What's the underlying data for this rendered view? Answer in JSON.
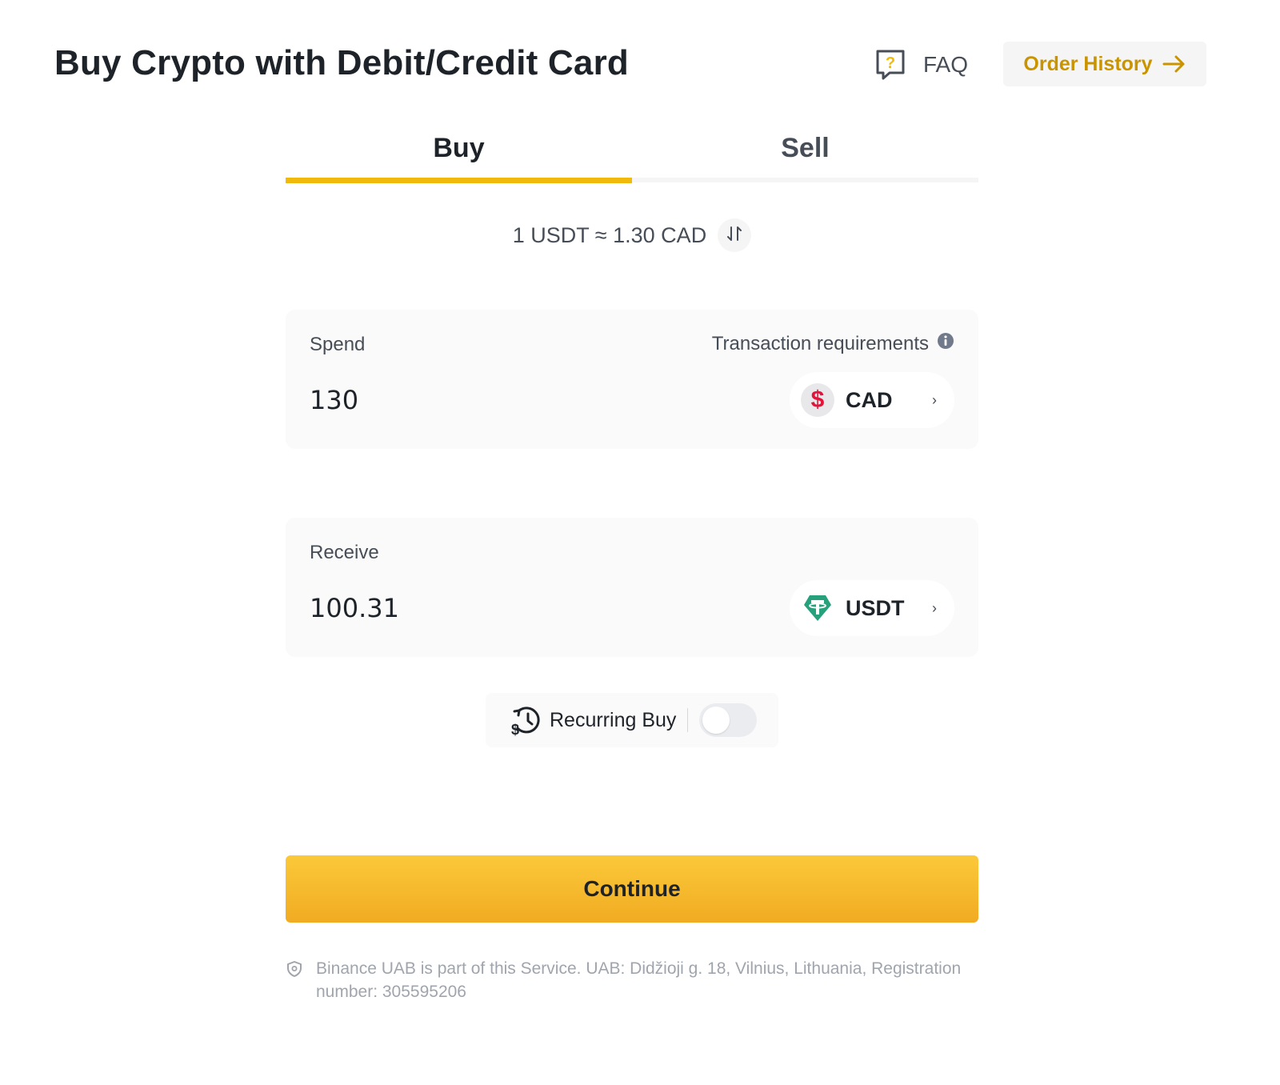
{
  "header": {
    "title": "Buy Crypto with Debit/Credit Card",
    "faq_label": "FAQ",
    "order_history_label": "Order History"
  },
  "tabs": [
    {
      "label": "Buy",
      "active": true
    },
    {
      "label": "Sell",
      "active": false
    }
  ],
  "rate": {
    "text": "1 USDT ≈ 1.30 CAD"
  },
  "spend": {
    "label": "Spend",
    "requirements_label": "Transaction requirements",
    "amount": "130",
    "currency": "CAD",
    "currency_icon": "dollar-sign-icon"
  },
  "receive": {
    "label": "Receive",
    "amount": "100.31",
    "currency": "USDT",
    "currency_icon": "tether-icon"
  },
  "recurring": {
    "label": "Recurring Buy",
    "enabled": false
  },
  "continue_label": "Continue",
  "disclaimer": "Binance UAB is part of this Service. UAB: Didžioji g. 18, Vilnius, Lithuania, Registration number: 305595206",
  "colors": {
    "accent": "#f0b90b",
    "accent_text": "#c99400",
    "usdt_green": "#26a17b",
    "cad_red": "#e3143b"
  }
}
